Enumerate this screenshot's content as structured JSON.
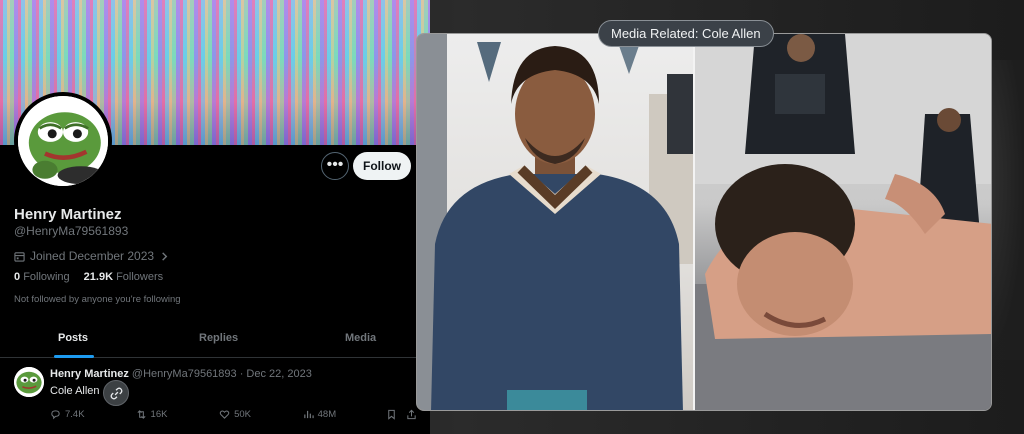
{
  "profile": {
    "name": "Henry Martinez",
    "handle": "@HenryMa79561893",
    "joined": "Joined December 2023",
    "following_count": "0",
    "following_label": "Following",
    "followers_count": "21.9K",
    "followers_label": "Followers",
    "not_followed": "Not followed by anyone you're following",
    "more_label": "•••",
    "follow_label": "Follow",
    "avatar_icon": "pepe-frog-avatar"
  },
  "tabs": [
    {
      "label": "Posts",
      "active": true
    },
    {
      "label": "Replies",
      "active": false
    },
    {
      "label": "Media",
      "active": false
    }
  ],
  "tweet": {
    "name": "Henry Martinez",
    "handle_date": "@HenryMa79561893 · Dec 22, 2023",
    "text": "Cole Allen",
    "replies": "7.4K",
    "reposts": "16K",
    "likes": "50K",
    "views": "48M"
  },
  "media": {
    "label": "Media Related: Cole Allen"
  },
  "colors": {
    "accent": "#1d9bf0",
    "background": "#000000",
    "muted_text": "#71767b"
  }
}
